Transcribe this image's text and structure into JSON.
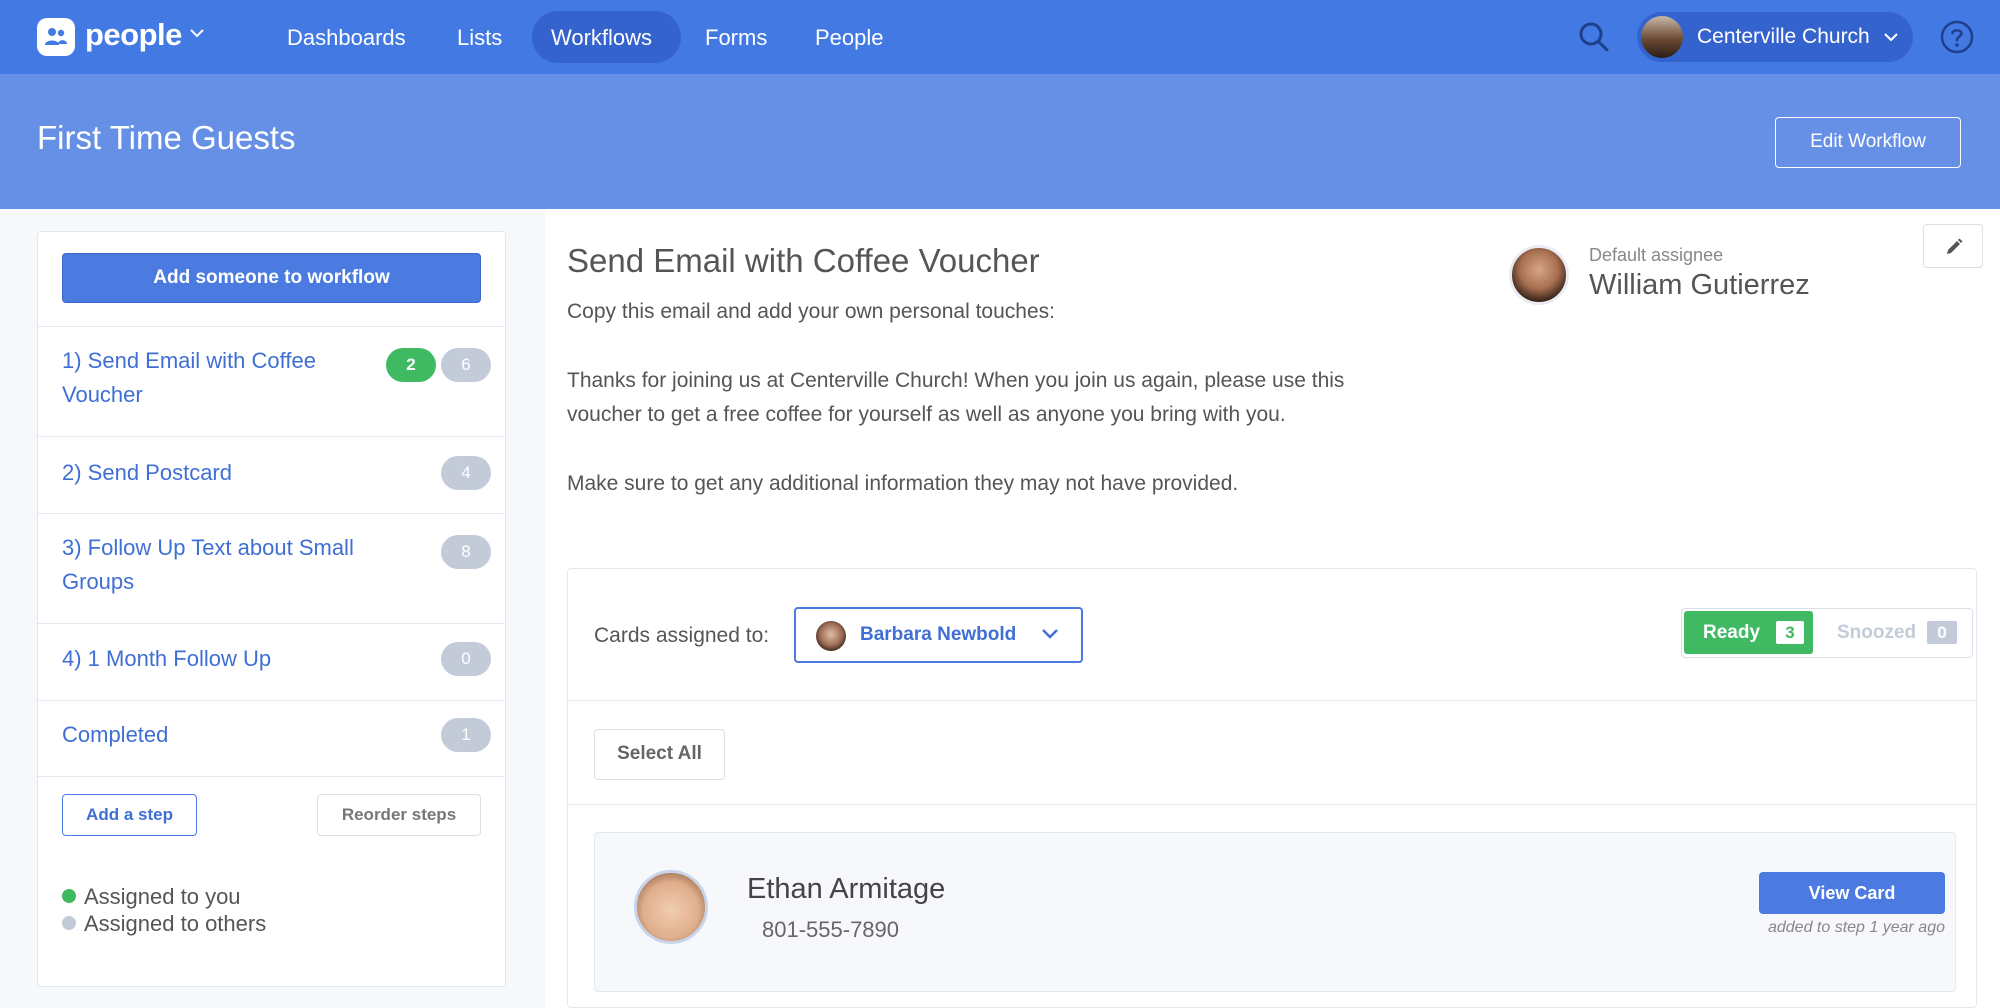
{
  "app": {
    "name": "people"
  },
  "nav": {
    "items": [
      {
        "label": "Dashboards"
      },
      {
        "label": "Lists"
      },
      {
        "label": "Workflows",
        "active": true
      },
      {
        "label": "Forms"
      },
      {
        "label": "People"
      }
    ]
  },
  "account": {
    "name": "Centerville Church"
  },
  "header": {
    "title": "First Time Guests",
    "edit_label": "Edit Workflow"
  },
  "sidebar": {
    "add_button": "Add someone to workflow",
    "steps": [
      {
        "label": "1) Send Email with Coffee Voucher",
        "badge_green": "2",
        "badge_gray": "6"
      },
      {
        "label": "2) Send Postcard",
        "badge_gray": "4"
      },
      {
        "label": "3) Follow Up Text about Small Groups",
        "badge_gray": "8"
      },
      {
        "label": "4) 1 Month Follow Up",
        "badge_gray": "0"
      },
      {
        "label": "Completed",
        "badge_gray": "1"
      }
    ],
    "add_step": "Add a step",
    "reorder": "Reorder steps",
    "legend": {
      "you": "Assigned to you",
      "others": "Assigned to others",
      "you_color": "#3fba62",
      "others_color": "#c3cbd9"
    }
  },
  "main": {
    "step_title": "Send Email with Coffee Voucher",
    "description": [
      "Copy this email and add your own personal touches:",
      "Thanks for joining us at Centerville Church! When you join us again, please use this",
      "voucher to get a free coffee for yourself as well as anyone you bring with you.",
      "Make sure to get any additional information they may not have provided."
    ],
    "assignee_label": "Default assignee",
    "assignee_name": "William Gutierrez",
    "cards_label": "Cards assigned to:",
    "cards_assignee": "Barbara Newbold",
    "ready_label": "Ready",
    "ready_count": "3",
    "snoozed_label": "Snoozed",
    "snoozed_count": "0",
    "select_all": "Select All",
    "card": {
      "name": "Ethan Armitage",
      "phone": "801-555-7890",
      "view_label": "View Card",
      "added": "added to step 1 year ago"
    }
  },
  "colors": {
    "nav": "#4379e3",
    "header": "#6690e6",
    "accent": "#4b7be1",
    "green": "#3fba62"
  }
}
